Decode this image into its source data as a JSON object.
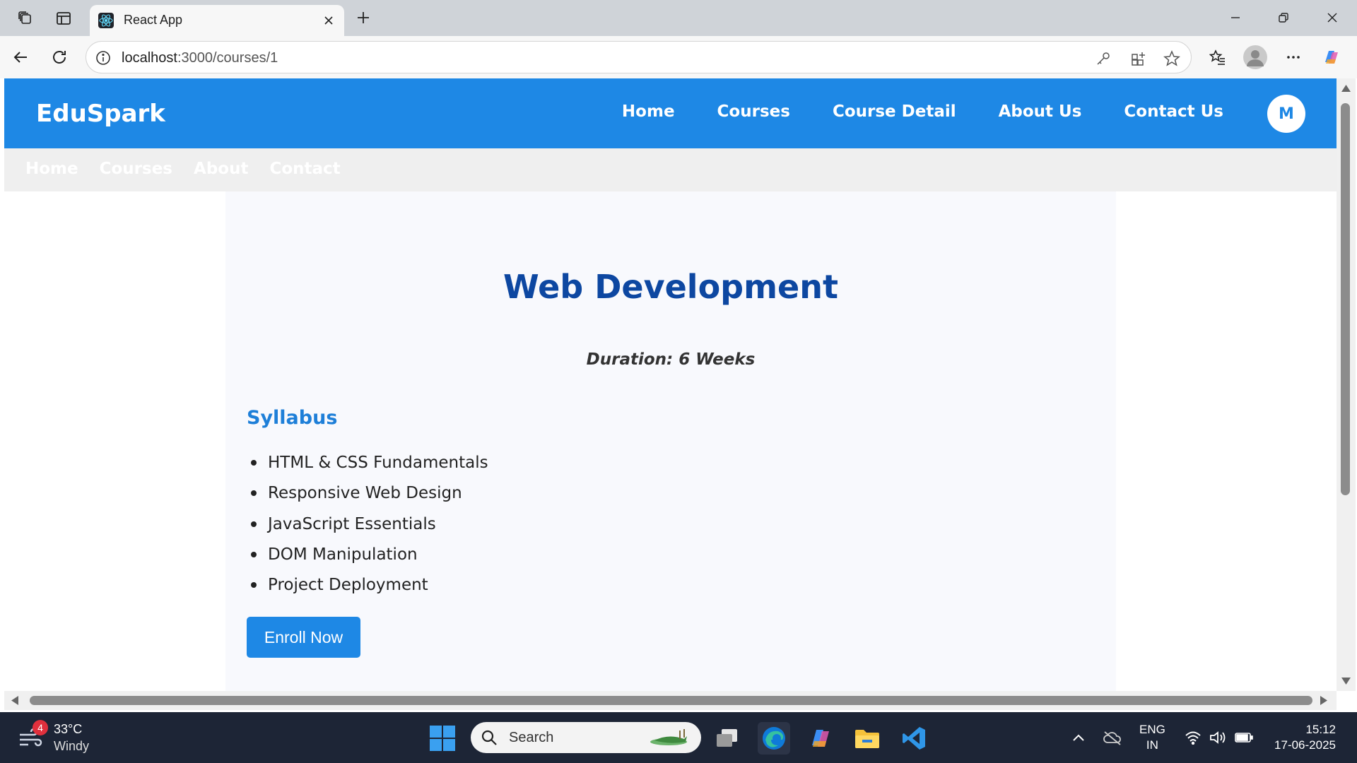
{
  "browser": {
    "tab_title": "React App",
    "url_host": "localhost",
    "url_path": ":3000/courses/1"
  },
  "app": {
    "brand": "EduSpark",
    "nav": [
      "Home",
      "Courses",
      "Course Detail",
      "About Us",
      "Contact Us"
    ],
    "avatar_initial": "M",
    "subnav": [
      "Home",
      "Courses",
      "About",
      "Contact"
    ]
  },
  "course": {
    "title": "Web Development",
    "duration": "Duration: 6 Weeks",
    "syllabus_heading": "Syllabus",
    "syllabus": [
      "HTML & CSS Fundamentals",
      "Responsive Web Design",
      "JavaScript Essentials",
      "DOM Manipulation",
      "Project Deployment"
    ],
    "enroll_label": "Enroll Now"
  },
  "taskbar": {
    "weather_badge": "4",
    "temperature": "33°C",
    "condition": "Windy",
    "search_placeholder": "Search",
    "lang_line1": "ENG",
    "lang_line2": "IN",
    "time": "15:12",
    "date": "17-06-2025"
  },
  "colors": {
    "header_blue": "#1e88e5",
    "title_blue": "#0d47a1",
    "syllabus_blue": "#1e7fd8",
    "taskbar_bg": "#1d2536"
  }
}
